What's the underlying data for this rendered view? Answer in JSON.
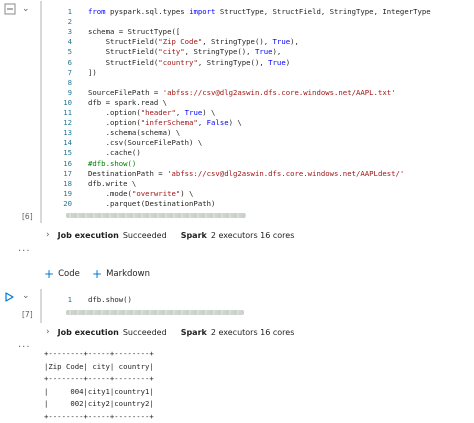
{
  "cell1": {
    "exec_count": "[6]",
    "lines": [
      {
        "n": "1",
        "html": "<span class='k'>from</span> pyspark.sql.types <span class='k'>import</span> StructType, StructField, StringType, IntegerType"
      },
      {
        "n": "2",
        "html": ""
      },
      {
        "n": "3",
        "html": "schema = StructType(["
      },
      {
        "n": "4",
        "html": "    StructField(<span class='s'>\"Zip Code\"</span>, StringType(), <span class='k'>True</span>),"
      },
      {
        "n": "5",
        "html": "    StructField(<span class='s'>\"city\"</span>, StringType(), <span class='k'>True</span>),"
      },
      {
        "n": "6",
        "html": "    StructField(<span class='s'>\"country\"</span>, StringType(), <span class='k'>True</span>)"
      },
      {
        "n": "7",
        "html": "])"
      },
      {
        "n": "8",
        "html": ""
      },
      {
        "n": "9",
        "html": "SourceFilePath = <span class='s'>'abfss://csv@dlg2aswin.dfs.core.windows.net/AAPL.txt'</span>"
      },
      {
        "n": "10",
        "html": "dfb = spark.read \\"
      },
      {
        "n": "11",
        "html": "    .option(<span class='s'>\"header\"</span>, <span class='k'>True</span>) \\"
      },
      {
        "n": "12",
        "html": "    .option(<span class='s'>\"inferSchema\"</span>, <span class='k'>False</span>) \\"
      },
      {
        "n": "13",
        "html": "    .schema(schema) \\"
      },
      {
        "n": "14",
        "html": "    .csv(SourceFilePath) \\"
      },
      {
        "n": "15",
        "html": "    .cache()"
      },
      {
        "n": "16",
        "html": "<span class='c'>#dfb.show()</span>"
      },
      {
        "n": "17",
        "html": "DestinationPath = <span class='s'>'abfss://csv@dlg2aswin.dfs.core.windows.net/AAPLdest/'</span>"
      },
      {
        "n": "18",
        "html": "dfb.write \\"
      },
      {
        "n": "19",
        "html": "    .mode(<span class='s'>\"overwrite\"</span>) \\"
      },
      {
        "n": "20",
        "html": "    .parquet(DestinationPath)"
      }
    ]
  },
  "exec1": {
    "job": "Job execution",
    "status": "Succeeded",
    "spark": "Spark",
    "detail": "2 executors 16 cores"
  },
  "add": {
    "code": "Code",
    "markdown": "Markdown"
  },
  "cell2": {
    "exec_count": "[7]",
    "lines": [
      {
        "n": "1",
        "html": "dfb.show()"
      }
    ]
  },
  "exec2": {
    "job": "Job execution",
    "status": "Succeeded",
    "spark": "Spark",
    "detail": "2 executors 16 cores"
  },
  "output": {
    "lines": [
      "+--------+-----+--------+",
      "|Zip Code| city| country|",
      "+--------+-----+--------+",
      "|     004|city1|country1|",
      "|     002|city2|country2|",
      "+--------+-----+--------+"
    ]
  },
  "colors": {
    "accent": "#0078d4",
    "keyword": "#0000ff",
    "string": "#a31515",
    "comment": "#008000",
    "lineno": "#237893"
  }
}
